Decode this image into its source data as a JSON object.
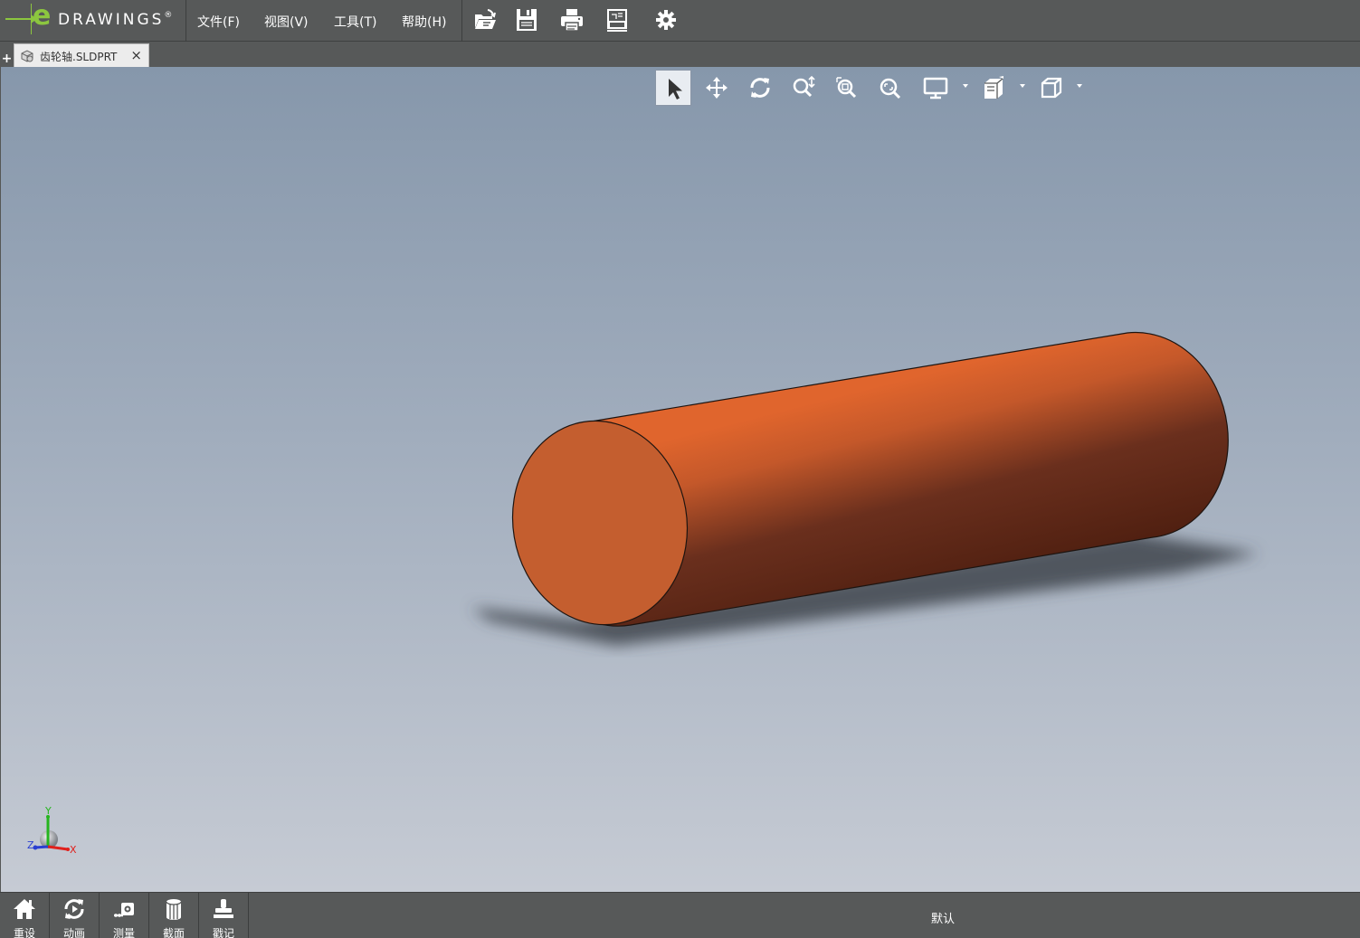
{
  "app": {
    "logo_letter": "e",
    "logo_text": "DRAWINGS",
    "logo_mark": "®"
  },
  "menu": {
    "file": "文件(F)",
    "view": "视图(V)",
    "tools": "工具(T)",
    "help": "帮助(H)"
  },
  "toolbar": {
    "icons": [
      "open-icon",
      "save-icon",
      "print-icon",
      "publish-icon",
      "settings-icon"
    ]
  },
  "tabs": {
    "add_symbol": "+",
    "document_tab_label": "齿轮轴.SLDPRT",
    "close_symbol": "×"
  },
  "view_toolbar": {
    "icons": [
      "select-icon",
      "pan-icon",
      "rotate-icon",
      "zoom-icon",
      "zoom-to-area-icon",
      "zoom-to-fit-icon",
      "display-style-icon",
      "section-view-icon",
      "standard-views-icon"
    ],
    "active_tool": "select"
  },
  "triad": {
    "x_label": "X",
    "y_label": "Y",
    "z_label": "Z",
    "x_color": "#e0201c",
    "y_color": "#26b51f",
    "z_color": "#2a3fd1"
  },
  "model": {
    "shape": "cylinder",
    "color": "#c45e2f"
  },
  "bottom_bar": {
    "reset_label": "重设",
    "animate_label": "动画",
    "measure_label": "测量",
    "section_label": "截面",
    "stamp_label": "戳记",
    "configuration_label": "默认"
  },
  "colors": {
    "chrome": "#575959",
    "accent": "#8cc63f",
    "viewport_top": "#8697ab",
    "viewport_bottom": "#c6cbd4"
  }
}
